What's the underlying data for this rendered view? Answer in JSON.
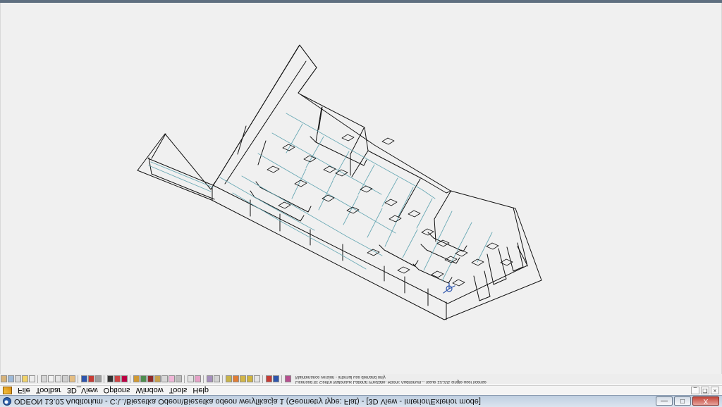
{
  "window": {
    "title": "ODEON 13.02 Auditorium  -  C:\\..\\Biezetka Odeon\\Biezetka odeon weryfikacja 1      (Geometry type: Flat) - [3D View - Interior/Exterior mode]",
    "controls": {
      "minimize": "—",
      "maximize": "□",
      "close": "X"
    }
  },
  "menu": {
    "items": [
      "File",
      "Toolbar",
      "3D_View",
      "Options",
      "Window",
      "Tools",
      "Help"
    ],
    "mdi_controls": {
      "minimize": "_",
      "restore": "❐",
      "close": "×"
    }
  },
  "toolbar": {
    "status_line_1": "Licensed to: Centre Materiaux Laborat Prestatie. Room: Auditorium... Issue 13.201 single-user license",
    "status_line_2": "Maintenance version - internal use demand only"
  },
  "icons": {
    "app": "odeon-app-icon",
    "menu": "odeon-menu-icon"
  },
  "colors": {
    "wireframe": "#111111",
    "teal": "#64a6b2",
    "canvas": "#f0f0f0",
    "titlebar": "#cdd9e7",
    "close": "#c4473b"
  }
}
